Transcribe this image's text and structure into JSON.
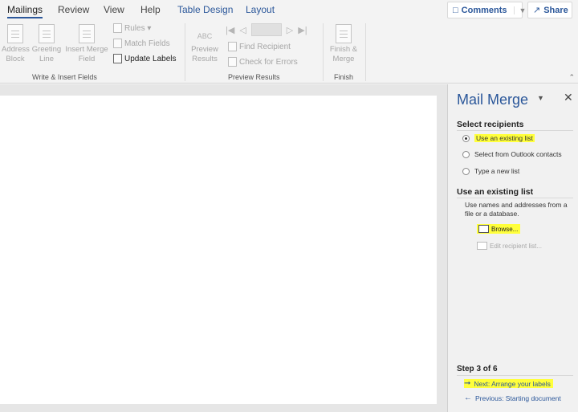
{
  "tabs": {
    "mailings": "Mailings",
    "review": "Review",
    "view": "View",
    "help": "Help",
    "table_design": "Table Design",
    "layout": "Layout"
  },
  "top_buttons": {
    "comments": "Comments",
    "share": "Share"
  },
  "ribbon": {
    "write_insert": {
      "address_block": "Address Block",
      "greeting_line": "Greeting Line",
      "insert_merge_field": "Insert Merge Field",
      "rules": "Rules",
      "match_fields": "Match Fields",
      "update_labels": "Update Labels",
      "group_label": "Write & Insert Fields"
    },
    "preview": {
      "abc_label": "ABC",
      "preview_results": "Preview Results",
      "find_recipient": "Find Recipient",
      "check_errors": "Check for Errors",
      "group_label": "Preview Results"
    },
    "finish": {
      "finish_merge": "Finish & Merge",
      "group_label": "Finish"
    }
  },
  "pane": {
    "title": "Mail Merge",
    "select_recipients_heading": "Select recipients",
    "options": [
      {
        "label": "Use an existing list",
        "selected": true
      },
      {
        "label": "Select from Outlook contacts",
        "selected": false
      },
      {
        "label": "Type a new list",
        "selected": false
      }
    ],
    "existing_list_heading": "Use an existing list",
    "description": "Use names and addresses from a file or a database.",
    "browse": "Browse...",
    "edit_recipient_list": "Edit recipient list...",
    "step": "Step 3 of 6",
    "next": "Next: Arrange your labels",
    "previous": "Previous: Starting document"
  },
  "colors": {
    "accent": "#2b579a",
    "highlight": "#ffff3b"
  }
}
